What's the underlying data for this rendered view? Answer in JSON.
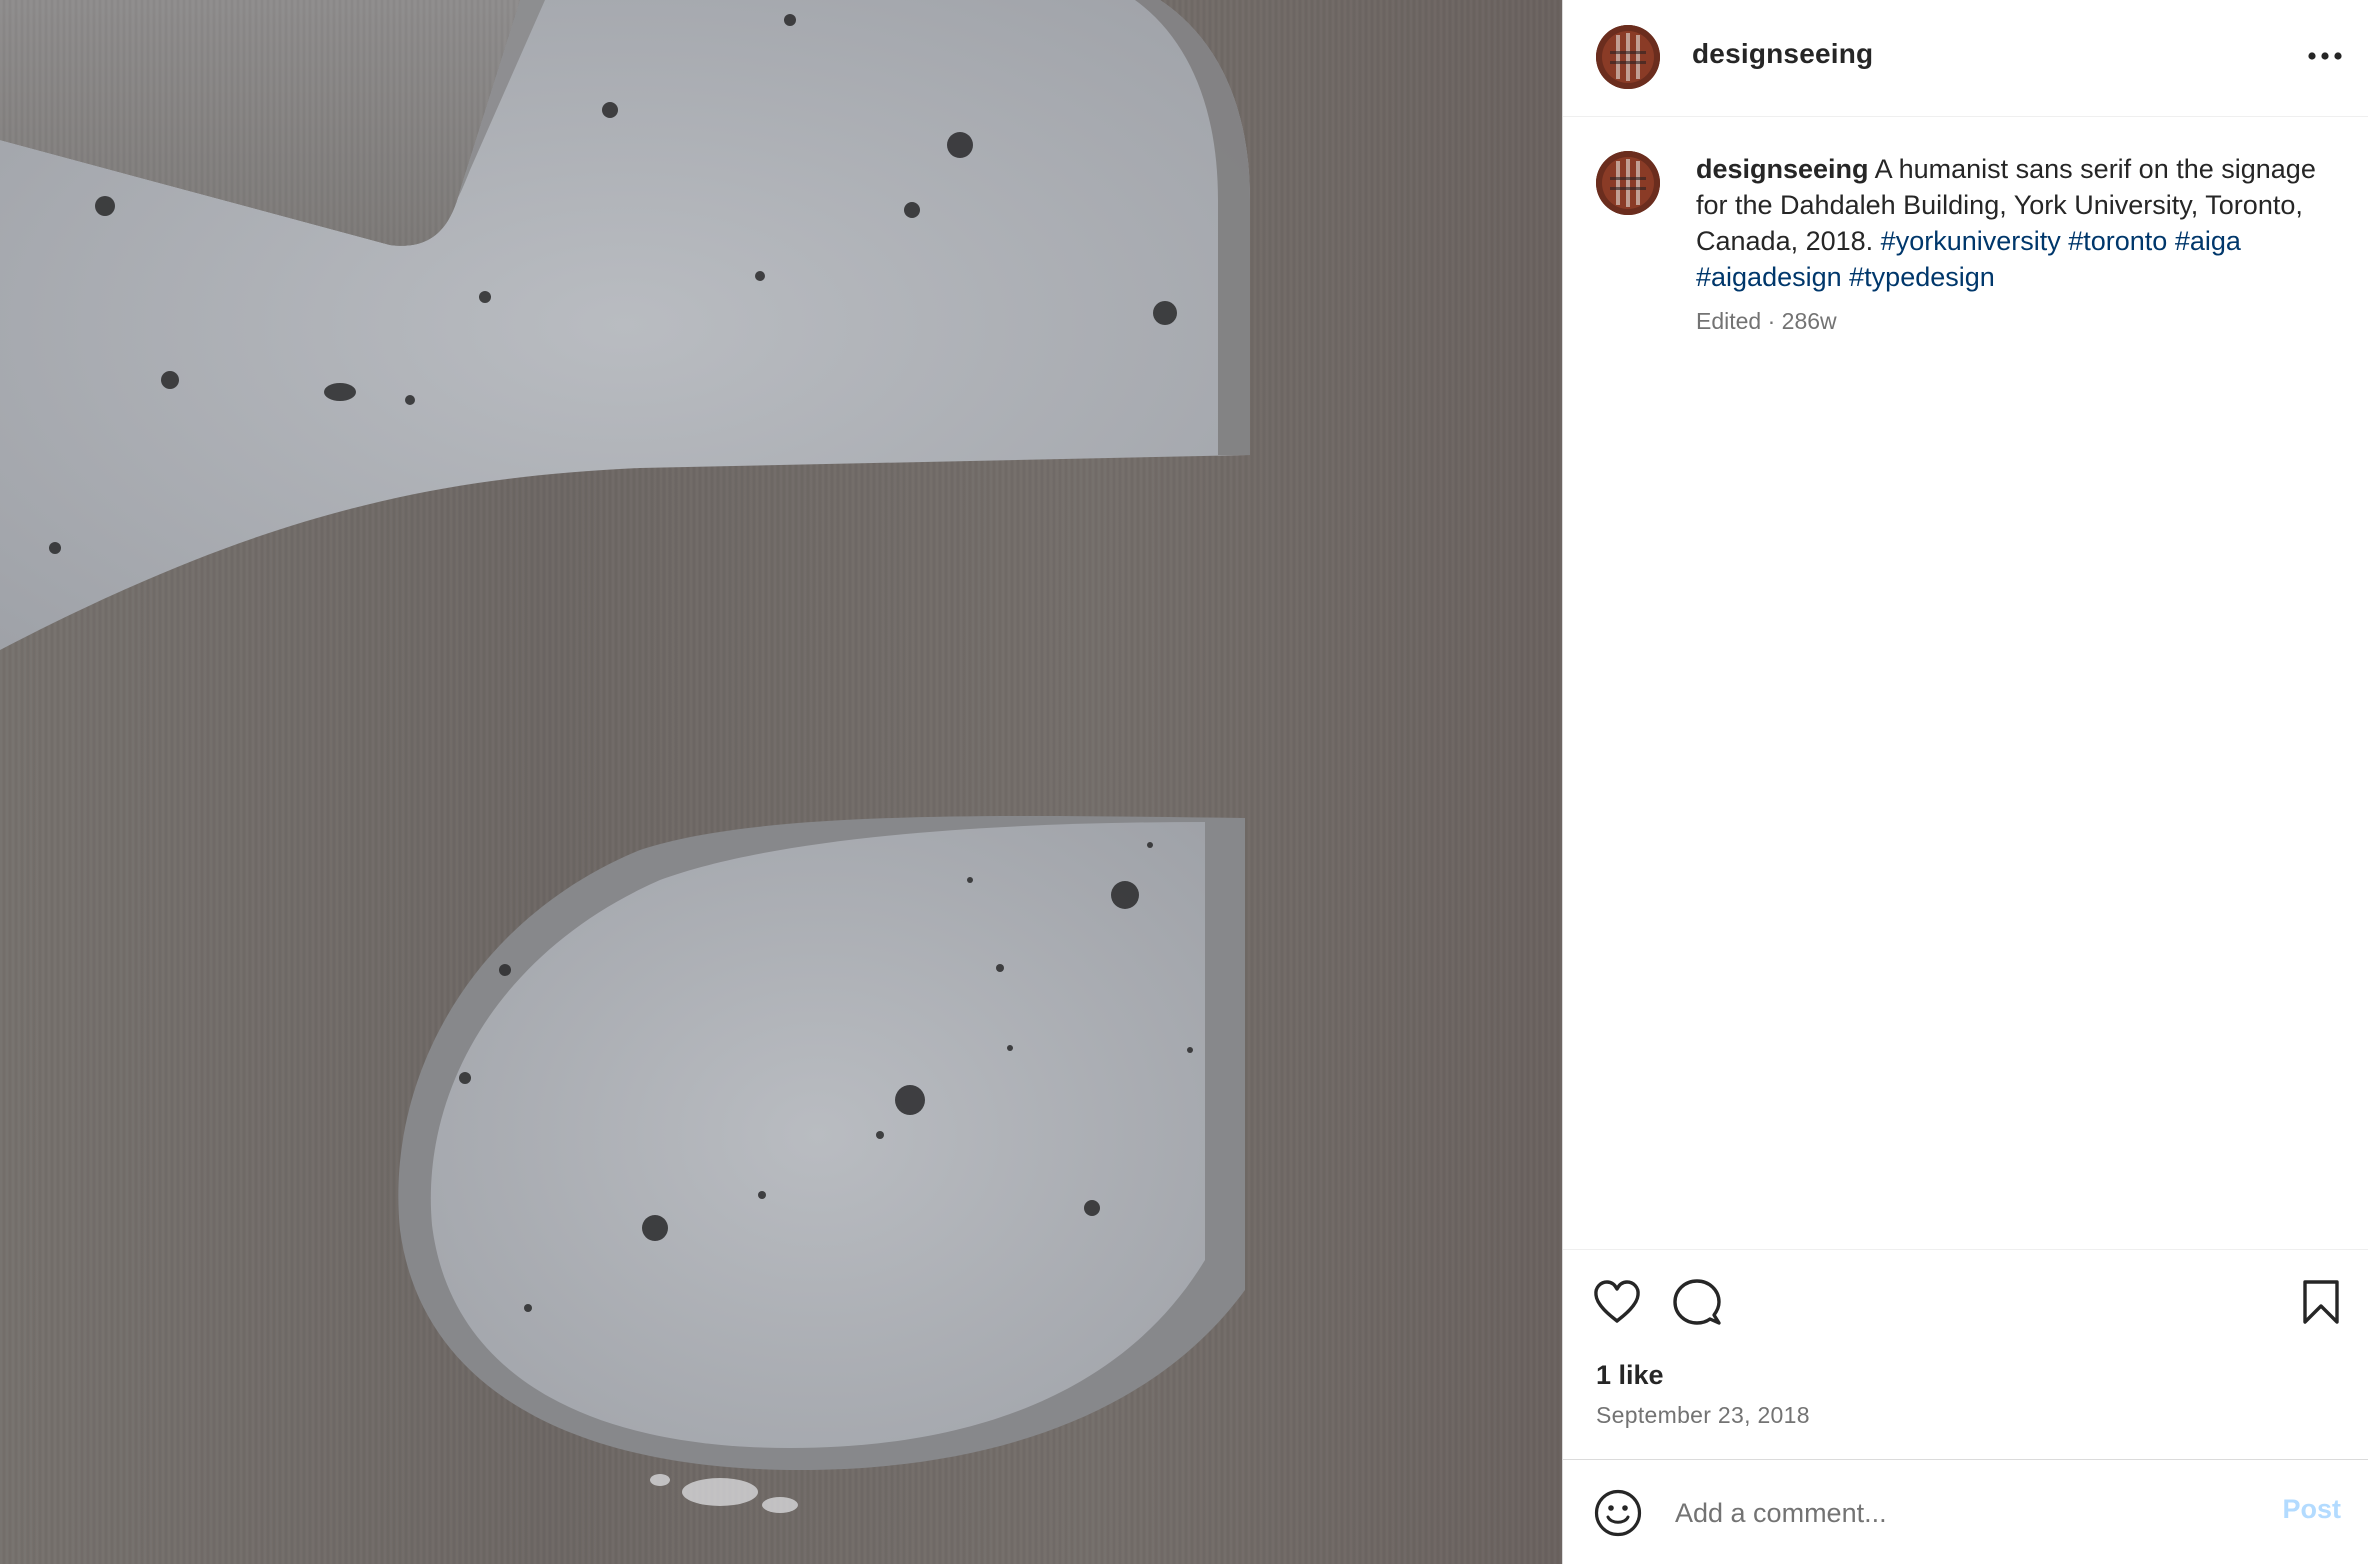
{
  "post": {
    "username": "designseeing",
    "caption_text": "A humanist sans serif on the signage for the Dahdaleh Building, York University, Toronto, Canada, 2018.",
    "hashtags": [
      "#yorkuniversity",
      "#toronto",
      "#aiga",
      "#aigadesign",
      "#typedesign"
    ],
    "meta": "Edited · 286w",
    "likes": "1 like",
    "date": "September 23, 2018"
  },
  "comment": {
    "placeholder": "Add a comment...",
    "post_label": "Post"
  },
  "icons": {
    "more": "more-options-icon",
    "like": "heart-icon",
    "comment": "comment-bubble-icon",
    "save": "bookmark-icon",
    "emoji": "emoji-icon"
  },
  "colors": {
    "hashtag": "#00376b",
    "post_button": "#b3dbff",
    "secondary_text": "#737373"
  }
}
